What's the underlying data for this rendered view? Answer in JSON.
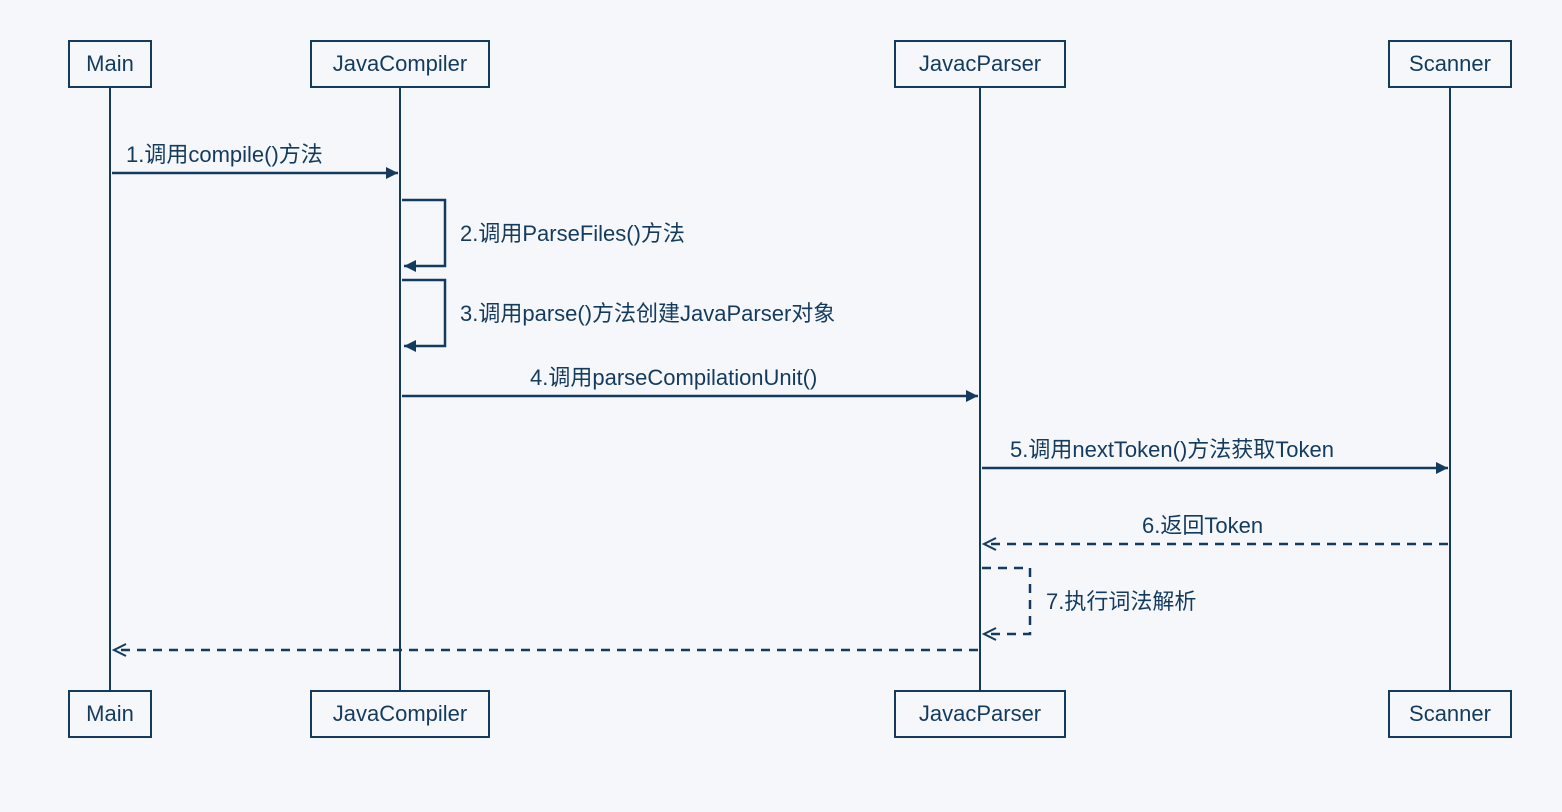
{
  "participants": [
    {
      "id": "main",
      "label": "Main"
    },
    {
      "id": "compiler",
      "label": "JavaCompiler"
    },
    {
      "id": "parser",
      "label": "JavacParser"
    },
    {
      "id": "scanner",
      "label": "Scanner"
    }
  ],
  "messages": [
    {
      "id": "m1",
      "text": "1.调用compile()方法"
    },
    {
      "id": "m2",
      "text": "2.调用ParseFiles()方法"
    },
    {
      "id": "m3",
      "text": "3.调用parse()方法创建JavaParser对象"
    },
    {
      "id": "m4",
      "text": "4.调用parseCompilationUnit()"
    },
    {
      "id": "m5",
      "text": "5.调用nextToken()方法获取Token"
    },
    {
      "id": "m6",
      "text": "6.返回Token"
    },
    {
      "id": "m7",
      "text": "7.执行词法解析"
    }
  ]
}
